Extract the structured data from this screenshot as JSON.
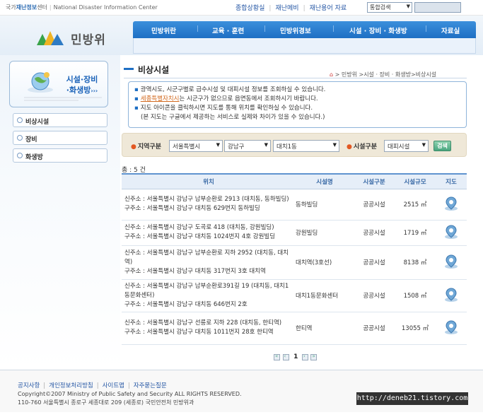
{
  "topbar": {
    "brand_prefix": "국가",
    "brand_highlight": "재난정보",
    "brand_suffix": "센터",
    "brand_en": "National Disaster Information Center",
    "links": [
      "종합상황실",
      "재난메비",
      "재난용어 자료"
    ],
    "search_select": "통합검색"
  },
  "logo": {
    "name": "민방위"
  },
  "gnb": {
    "items": [
      "민방위란",
      "교육 · 훈련",
      "민방위경보",
      "시설 · 장비 · 화생방",
      "자료실"
    ]
  },
  "lnb": {
    "title_line1": "시설·장비",
    "title_line2": "·화생방",
    "title_arrows": "›››",
    "menu": [
      "비상시설",
      "장비",
      "화생방"
    ]
  },
  "content": {
    "title": "비상시설",
    "breadcrumb": "> 민방위 >시설 · 장비 · 화생방>비상시설",
    "notice": {
      "line1": "광역시도, 시군구별로 급수시설 및 대피시설 정보를 조회하실 수 있습니다.",
      "line2_link": "세종특별자치시",
      "line2_rest": "는 시군구가 없으므로 읍면동에서 조회하시기 바랍니다.",
      "line3": "지도 아이콘을 클릭하시면 지도를 통해 위치를 확인하실 수 있습니다.",
      "line4": "(본 지도는 구글에서 제공하는 서비스로 실제와 차이가 있을 수 있습니다.)"
    },
    "filter": {
      "region_label": "지역구분",
      "sido": "서울특별시",
      "sigungu": "강남구",
      "dong": "대치1동",
      "facility_label": "시설구분",
      "facility": "대피시설",
      "search_button": "검색"
    },
    "total": "총 : 5 건",
    "table": {
      "headers": [
        "위치",
        "시설명",
        "시설구분",
        "시설규모",
        "지도"
      ],
      "rows": [
        {
          "new_addr": "신주소 : 서울특별시 강남구 남부순환로 2913 (대치동, 동하빌딩)",
          "old_addr": "구주소 : 서울특별시 강남구 대치동 629번지 동하빌딩",
          "name": "동하빌딩",
          "type": "공공시설",
          "size": "2515 ㎡"
        },
        {
          "new_addr": "신주소 : 서울특별시 강남구 도곡로 418 (대치동, 강원빌딩)",
          "old_addr": "구주소 : 서울특별시 강남구 대치동 1024번지 4호 강원빌딩",
          "name": "강원빌딩",
          "type": "공공시설",
          "size": "1719 ㎡"
        },
        {
          "new_addr": "신주소 : 서울특별시 강남구 남부순환로 지하 2952 (대치동, 대치역)",
          "old_addr": "구주소 : 서울특별시 강남구 대치동 317번지 3호 대치역",
          "name": "대치역(3호선)",
          "type": "공공시설",
          "size": "8138 ㎡"
        },
        {
          "new_addr": "신주소 : 서울특별시 강남구 남부순환로391길 19 (대치동, 대치1동문화센터)",
          "old_addr": "구주소 : 서울특별시 강남구 대치동 646번지 2호",
          "name": "대치1동문화센터",
          "type": "공공시설",
          "size": "1508 ㎡"
        },
        {
          "new_addr": "신주소 : 서울특별시 강남구 선릉로 지하 228 (대치동, 한티역)",
          "old_addr": "구주소 : 서울특별시 강남구 대치동 1011번지 28호 한티역",
          "name": "한티역",
          "type": "공공시설",
          "size": "13055 ㎡"
        }
      ]
    },
    "pager": {
      "current": "1"
    }
  },
  "footer": {
    "links": [
      "공지사항",
      "개인정보처리방침",
      "사이트맵",
      "자주묻는질문"
    ],
    "copyright": "Copyright©2007 Ministry of Public Safety and Security ALL RIGHTS RESERVED.",
    "address": "110-760 서울특별시 종로구 세종대로 209 (세종로) 국민안전처 민방위과"
  },
  "watermark": "http://deneb21.tistory.com"
}
